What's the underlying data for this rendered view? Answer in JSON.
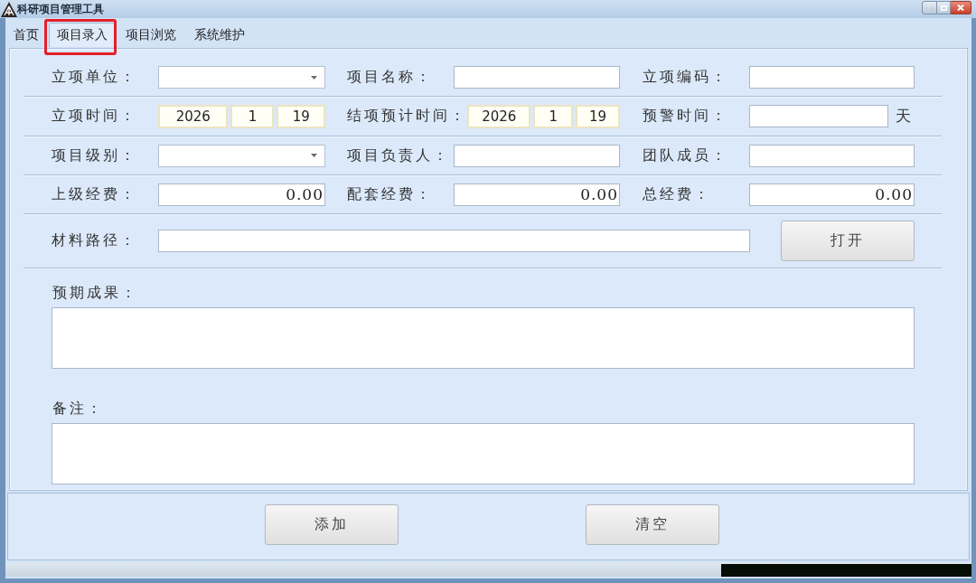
{
  "window": {
    "title": "科研项目管理工具"
  },
  "tabs": [
    {
      "label": "首页",
      "selected": false,
      "annotated": false
    },
    {
      "label": "项目录入",
      "selected": true,
      "annotated": true
    },
    {
      "label": "项目浏览",
      "selected": false,
      "annotated": false
    },
    {
      "label": "系统维护",
      "selected": false,
      "annotated": false
    }
  ],
  "form": {
    "rows": [
      {
        "fields": [
          {
            "kind": "combo",
            "label": "立项单位："
          },
          {
            "kind": "text",
            "label": "项目名称："
          },
          {
            "kind": "text",
            "label": "立项编码："
          }
        ]
      },
      {
        "fields": [
          {
            "kind": "date",
            "label": "立项时间：",
            "parts": [
              "2026",
              "1",
              "19"
            ]
          },
          {
            "kind": "date",
            "label": "结项预计时间：",
            "parts": [
              "2026",
              "1",
              "19"
            ]
          },
          {
            "kind": "text",
            "label": "预警时间：",
            "unit": "天"
          }
        ]
      },
      {
        "fields": [
          {
            "kind": "combo",
            "label": "项目级别："
          },
          {
            "kind": "text",
            "label": "项目负责人："
          },
          {
            "kind": "text",
            "label": "团队成员："
          }
        ]
      },
      {
        "fields": [
          {
            "kind": "amount",
            "label": "上级经费：",
            "value": "0.00"
          },
          {
            "kind": "amount",
            "label": "配套经费：",
            "value": "0.00"
          },
          {
            "kind": "amount",
            "label": "总经费：",
            "value": "0.00"
          }
        ]
      }
    ],
    "path": {
      "label": "材料路径：",
      "button": "打开"
    },
    "text_areas": [
      {
        "label": "预期成果："
      },
      {
        "label": "备注："
      }
    ]
  },
  "buttons": [
    "添加",
    "清空"
  ]
}
